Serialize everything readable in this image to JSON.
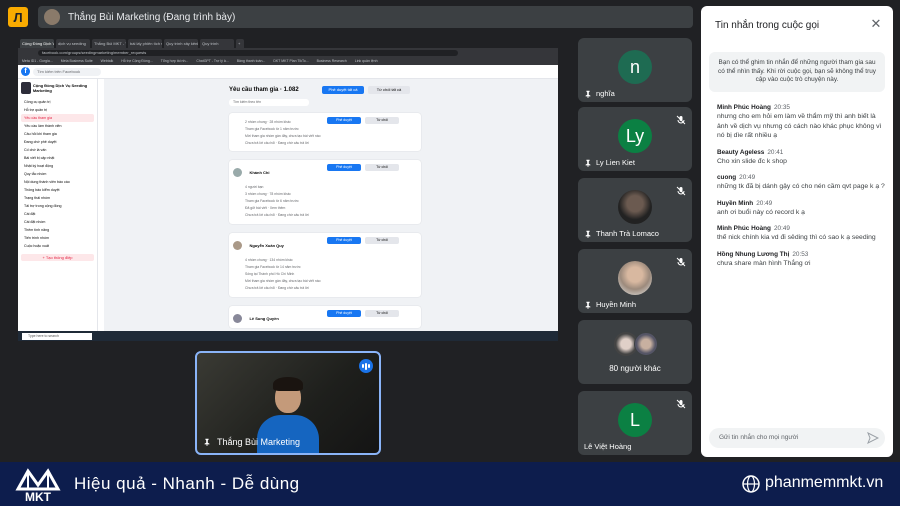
{
  "meeting": {
    "presenter_chip": "Thắng Bùi Marketing (Đang trình bày)",
    "presenter_name": "Thắng Bùi Marketing"
  },
  "shared_screen": {
    "tabs": [
      "Cộng Đồng Dịch Vụ Seeding",
      "dịch vụ seeding",
      "Thắng Bùi MKT - YouTube",
      "bài lấy phiên tích số học",
      "Quy trình xây kênh",
      "Quy trình",
      "+"
    ],
    "url": "facebook.com/groups/seedingmarketing/member_requests",
    "bookmarks": [
      "Meta ID1 - Gorgia...",
      "Meta Business Suite",
      "Webtalk",
      "Hỗ trợ Cộng Đồng...",
      "Tổng hợp tài nh...",
      "ChatGPT - Trợ lý ả...",
      "Bảng thanh toán...",
      "DKT MKT Plan TikTo...",
      "Business Research",
      "Link quản lệnh"
    ],
    "fb_search": "Tìm kiếm trên Facebook",
    "group_name": "Cộng Đồng Dịch Vụ Seeding Marketing",
    "side_items": [
      "Công cụ quản trị",
      "Hỗ trợ quản trị",
      "Yêu cầu tham gia",
      "Yêu cầu làm thành viên",
      "Câu hỏi khi tham gia",
      "Đang chờ phê duyệt",
      "Cố chờ là vấn",
      "Bài viết bị cập nhật",
      "Nhật ký hoạt động",
      "Quy tắc nhóm",
      "Nội dung thành viên báo cáo",
      "Thông báo kiểm duyệt",
      "Trạng thái nhóm",
      "Tài trợ trong cộng đồng",
      "Cài đặt",
      "Cài đặt nhóm",
      "Thêm tính năng",
      "Tiến trình nhóm",
      "Cuộc hoặc xuất"
    ],
    "side_button": "+ Tạo thông điệp",
    "page_title": "Yêu cầu tham gia · 1.082",
    "approve_all": "Phê duyệt tất cả",
    "decline_all": "Từ chối tất cả",
    "search_placeholder": "Tìm kiếm theo tên",
    "requests": [
      {
        "name": "",
        "lines": [
          "2 nhóm chung · 28 nhóm khác",
          "Tham gia Facebook từ 1 năm trước",
          "Mời tham gia nhóm gần đây, chưa tạo bài viết nào",
          "Chưa trả lời câu hỏi · Đang chờ câu trả lời"
        ]
      },
      {
        "name": "Khánh Chi",
        "lines": [
          "4 người bạn",
          "3 nhóm chung · 78 nhóm khác",
          "Tham gia Facebook từ 6 năm trước",
          "Đã gửi bài viết · Xem thêm",
          "Chưa trả lời câu hỏi · Đang chờ câu trả lời"
        ]
      },
      {
        "name": "Nguyễn Xuân Quy",
        "lines": [
          "4 nhóm chung · 134 nhóm khác",
          "Tham gia Facebook từ 14 năm trước",
          "Sống tại Thành phố Hồ Chí Minh",
          "Mời tham gia nhóm gần đây, chưa tạo bài viết nào",
          "Chưa trả lời câu hỏi · Đang chờ câu trả lời"
        ]
      },
      {
        "name": "Lê Sung Quyền",
        "lines": []
      }
    ],
    "approve_label": "Phê duyệt",
    "decline_label": "Từ chối",
    "taskbar_search": "Type here to search"
  },
  "participants": [
    {
      "name": "nghĩa",
      "initial": "n",
      "color": "#1e6b52"
    },
    {
      "name": "Ly Lien Kiet",
      "initial": "Ly",
      "color": "#0b8043"
    },
    {
      "name": "Thanh Trà Lomaco",
      "initial": "",
      "color": "#2b2b2b"
    },
    {
      "name": "Huyền Minh",
      "initial": "",
      "color": "#7b6a5e"
    },
    {
      "name": "80 người khác",
      "initial": "",
      "color": "#5f6368"
    },
    {
      "name": "Lê Việt Hoàng",
      "initial": "L",
      "color": "#0b8043"
    }
  ],
  "chat": {
    "title": "Tin nhắn trong cuộc gọi",
    "info": "Bạn có thể ghim tin nhắn để những người tham gia sau có thể nhìn thấy. Khi rời cuộc gọi, bạn sẽ không thể truy cập vào cuộc trò chuyện này.",
    "messages": [
      {
        "sender": "Minh Phúc Hoàng",
        "time": "20:35",
        "text": "nhưng cho em hỏi em làm về thẩm mỹ thì anh biết là ảnh về dịch vụ nhưng có cách nào khác phục không vì nó bị dìe rất nhiều ạ"
      },
      {
        "sender": "Beauty Ageless",
        "time": "20:41",
        "text": "Cho xin slide đc k shop"
      },
      {
        "sender": "cuong",
        "time": "20:49",
        "text": "những tk đã bị dánh gậy có cho nén cầm qvt page k ạ ?"
      },
      {
        "sender": "Huyền Minh",
        "time": "20:49",
        "text": "anh ơi buổi này có record k ạ"
      },
      {
        "sender": "Minh Phúc Hoàng",
        "time": "20:49",
        "text": "thế nick chính kia vd đi sêding thì có sao k ạ seeding"
      },
      {
        "sender": "Hồng Nhung Lương Thị",
        "time": "20:53",
        "text": "chưa share màn hình Thắng ơi"
      }
    ],
    "input_placeholder": "Gửi tin nhắn cho mọi người"
  },
  "footer": {
    "logo_text": "MKT",
    "tagline": "Hiệu quả - Nhanh - Dễ dùng",
    "website": "phanmemmkt.vn"
  },
  "colors": {
    "accent": "#1a73e8",
    "brand_navy": "#0d1d4d",
    "fb_blue": "#1877f2"
  }
}
